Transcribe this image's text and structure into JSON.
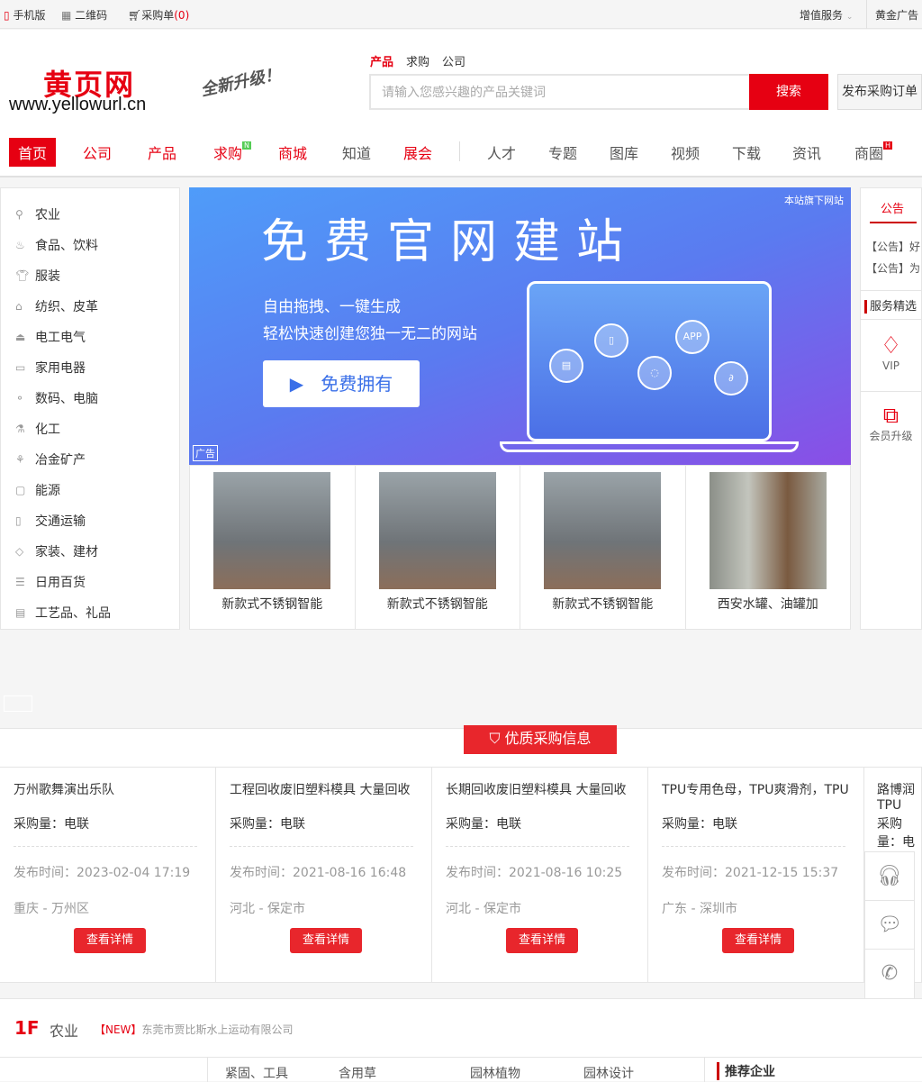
{
  "topbar": {
    "mobile": "手机版",
    "qrcode": "二维码",
    "cart": "采购单",
    "cart_count": "(0)",
    "services": "增值服务",
    "gold_ad": "黄金广告"
  },
  "header": {
    "logo_cn": "黄页网",
    "logo_url": "www.yellowurl.cn",
    "slogan": "全新升级！",
    "search_tabs": [
      "产品",
      "求购",
      "公司"
    ],
    "search_placeholder": "请输入您感兴趣的产品关键词",
    "search_button": "搜索",
    "publish_button": "发布采购订单"
  },
  "nav": [
    "首页",
    "公司",
    "产品",
    "求购",
    "商城",
    "知道",
    "展会",
    "人才",
    "专题",
    "图库",
    "视频",
    "下载",
    "资讯",
    "商圈"
  ],
  "nav_badges": {
    "qiugou": "N",
    "shangquan": "H"
  },
  "categories": [
    "农业",
    "食品、饮料",
    "服装",
    "纺织、皮革",
    "电工电气",
    "家用电器",
    "数码、电脑",
    "化工",
    "冶金矿产",
    "能源",
    "交通运输",
    "家装、建材",
    "日用百货",
    "工艺品、礼品"
  ],
  "banner": {
    "title": "免费官网建站",
    "line1": "自由拖拽、一键生成",
    "line2": "轻松快速创建您独一无二的网站",
    "button": "免费拥有",
    "tag": "本站旗下网站",
    "ad": "广告",
    "app": "APP"
  },
  "products": [
    "新款式不锈钢智能",
    "新款式不锈钢智能",
    "新款式不锈钢智能",
    "西安水罐、油罐加"
  ],
  "right_panel": {
    "tab": "公告",
    "notices": [
      "【公告】好",
      "【公告】为"
    ],
    "services_title": "服务精选",
    "vip": "VIP",
    "upgrade": "会员升级"
  },
  "purchase": {
    "title": "优质采购信息",
    "qty_label": "采购量：",
    "time_label": "发布时间：",
    "detail": "查看详情",
    "items": [
      {
        "name": "万州歌舞演出乐队",
        "qty": "电联",
        "time": "2023-02-04 17:19",
        "loc": "重庆 - 万州区"
      },
      {
        "name": "工程回收废旧塑料模具 大量回收",
        "qty": "电联",
        "time": "2021-08-16 16:48",
        "loc": "河北 - 保定市"
      },
      {
        "name": "长期回收废旧塑料模具 大量回收",
        "qty": "电联",
        "time": "2021-08-16 10:25",
        "loc": "河北 - 保定市"
      },
      {
        "name": "TPU专用色母，TPU爽滑剂，TPU",
        "qty": "电联",
        "time": "2021-12-15 15:37",
        "loc": "广东 - 深圳市"
      },
      {
        "name": "路博润TPU",
        "qty": "电联",
        "time": "",
        "loc": ""
      }
    ]
  },
  "floor": {
    "num": "1F",
    "name": "农业",
    "new_tag": "【NEW】",
    "new_company": "东莞市贾比斯水上运动有限公司",
    "subcats": [
      "紧固、工具",
      "含用草",
      "园林植物",
      "园林设计"
    ],
    "recommend": "推荐企业"
  }
}
